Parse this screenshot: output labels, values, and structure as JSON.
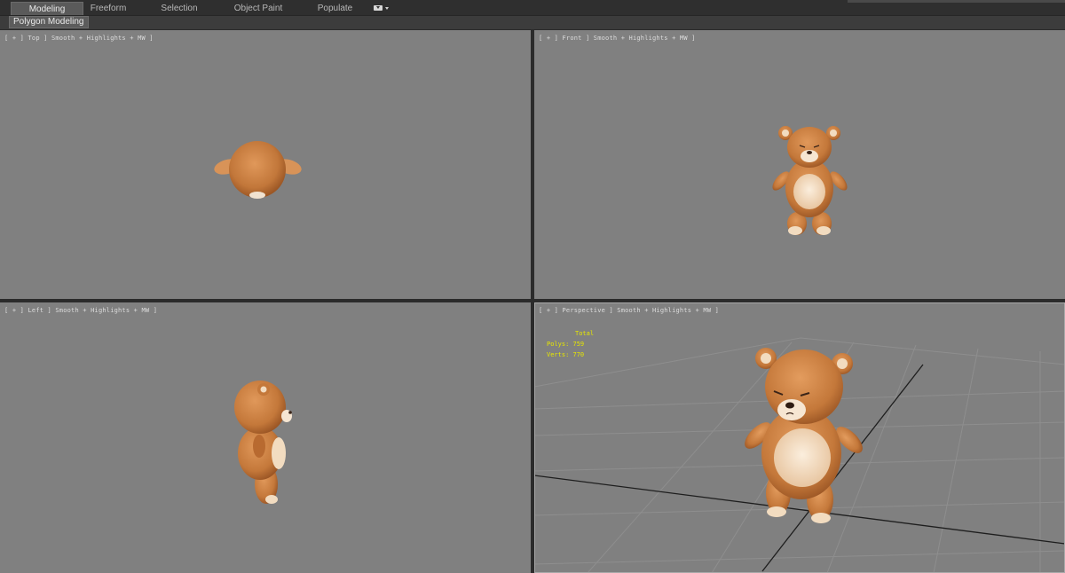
{
  "ribbon": {
    "tabs": [
      {
        "label": "Modeling",
        "active": true
      },
      {
        "label": "Freeform",
        "active": false
      },
      {
        "label": "Selection",
        "active": false
      },
      {
        "label": "Object Paint",
        "active": false
      },
      {
        "label": "Populate",
        "active": false
      }
    ],
    "panel_label": "Polygon Modeling"
  },
  "viewports": {
    "top": {
      "label": "[ + ] Top ] Smooth + Highlights + MW ]"
    },
    "front": {
      "label": "[ + ] Front ] Smooth + Highlights + MW ]"
    },
    "left": {
      "label": "[ + ] Left ] Smooth + Highlights + MW ]"
    },
    "perspective": {
      "label": "[ + ] Perspective ] Smooth + Highlights + MW ]",
      "stats": {
        "total": "Total",
        "polys": "Polys: 759",
        "verts": "Verts: 770"
      }
    }
  },
  "colors": {
    "viewport_bg": "#808080",
    "border": "#2b2b2b",
    "stats_text": "#e6e600",
    "bear_fur": "#c97a3c",
    "bear_belly": "#f2dcc0"
  },
  "icons": {
    "workspace_dropdown": "dropdown-icon"
  }
}
